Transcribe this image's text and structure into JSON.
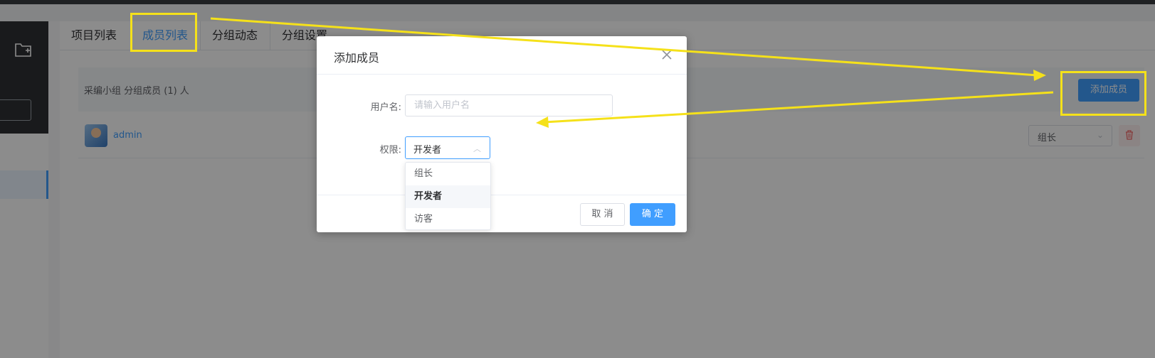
{
  "tabs": [
    {
      "label": "项目列表"
    },
    {
      "label": "成员列表"
    },
    {
      "label": "分组动态"
    },
    {
      "label": "分组设置"
    }
  ],
  "group": {
    "title": "采编小组 分组成员 (1) 人",
    "add_member_label": "添加成员"
  },
  "members": [
    {
      "name": "admin",
      "role": "组长"
    }
  ],
  "dialog": {
    "title": "添加成员",
    "username_label": "用户名:",
    "username_placeholder": "请输入用户名",
    "permission_label": "权限:",
    "permission_selected": "开发者",
    "permission_options": [
      "组长",
      "开发者",
      "访客"
    ],
    "cancel_label": "取 消",
    "confirm_label": "确 定"
  },
  "colors": {
    "primary": "#409eff",
    "annotation": "#f5e11a",
    "overlay": "rgba(0,0,0,0.45)"
  }
}
